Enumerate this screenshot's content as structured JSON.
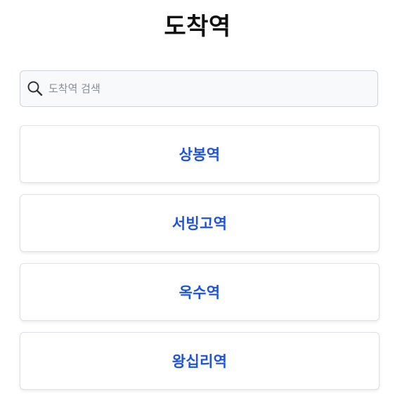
{
  "page": {
    "title": "도착역"
  },
  "search": {
    "placeholder": "도착역 검색",
    "value": ""
  },
  "stations": [
    {
      "label": "상봉역"
    },
    {
      "label": "서빙고역"
    },
    {
      "label": "옥수역"
    },
    {
      "label": "왕십리역"
    }
  ],
  "colors": {
    "accent": "#1f53d9",
    "title": "#111111",
    "search_bg": "#f8f9fb",
    "border": "#dee2e6"
  },
  "icons": {
    "search": "search-icon"
  }
}
